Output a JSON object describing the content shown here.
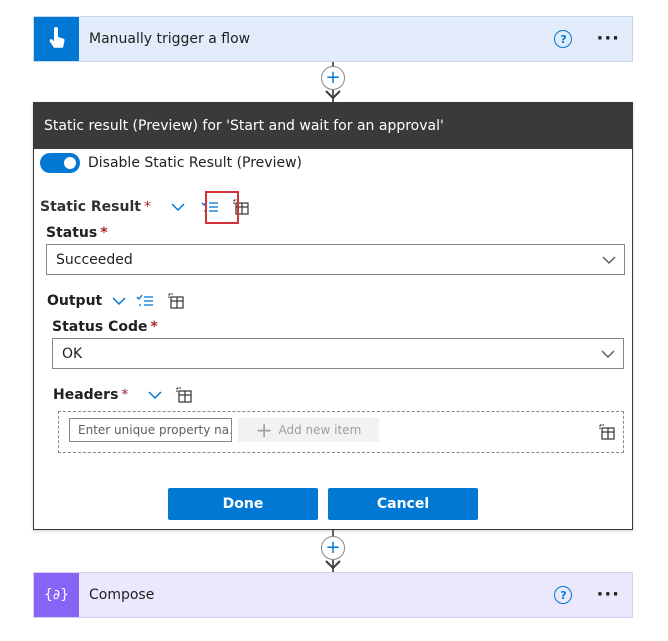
{
  "trigger": {
    "title": "Manually trigger a flow",
    "help": "?",
    "more": "···"
  },
  "connector_top": {
    "plus": "+"
  },
  "panel": {
    "header": "Static result (Preview) for 'Start and wait for an approval'",
    "toggle_label": "Disable Static Result (Preview)",
    "static_result_label": "Static Result",
    "required_mark": "*",
    "status": {
      "label": "Status",
      "value": "Succeeded"
    },
    "output_label": "Output",
    "status_code": {
      "label": "Status Code",
      "value": "OK"
    },
    "headers_label": "Headers",
    "property_placeholder": "Enter unique property na...",
    "add_item_label": "Add new item",
    "done_label": "Done",
    "cancel_label": "Cancel"
  },
  "connector_bottom": {
    "plus": "+"
  },
  "compose": {
    "title": "Compose",
    "help": "?",
    "more": "···",
    "icon_text": "{∂}"
  },
  "colors": {
    "accent": "#0078d4",
    "panel_header": "#3b3a39",
    "trigger_bg": "#e1ebfa",
    "compose_bg": "#ebe7fc",
    "compose_accent": "#8764f6",
    "highlight": "#d13438"
  }
}
